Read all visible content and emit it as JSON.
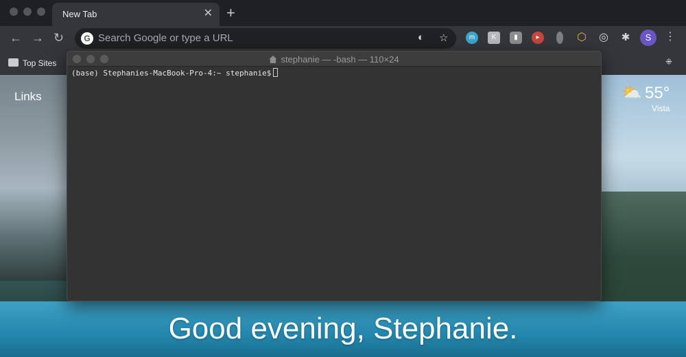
{
  "browser": {
    "tab": {
      "title": "New Tab"
    },
    "omnibox": {
      "placeholder": "Search Google or type a URL"
    },
    "extensions": [
      {
        "name": "m-extension-icon",
        "glyph": "m",
        "color": "#3aa6c9"
      },
      {
        "name": "k-extension-icon",
        "glyph": "K",
        "color": "#b5b8bc"
      },
      {
        "name": "shield-lock-icon",
        "glyph": "🔒",
        "color": "#8a8c90"
      },
      {
        "name": "red-record-icon",
        "glyph": "●",
        "color": "#c8453e"
      },
      {
        "name": "bulb-icon",
        "glyph": "●",
        "color": "#7d7f83"
      },
      {
        "name": "hexagon-icon",
        "glyph": "⬡",
        "color": "#e0a64b"
      },
      {
        "name": "target-icon",
        "glyph": "◎",
        "color": "#d5d7da"
      },
      {
        "name": "puzzle-icon",
        "glyph": "✱",
        "color": "#d5d7da"
      }
    ],
    "avatar_letter": "S",
    "bookmarks": {
      "label": "Top Sites"
    }
  },
  "new_tab": {
    "links_label": "Links",
    "weather": {
      "temp": "55°",
      "city": "Vista"
    },
    "greeting": "Good evening, Stephanie."
  },
  "terminal": {
    "title": "stephanie — -bash — 110×24",
    "prompt": "(base) Stephanies-MacBook-Pro-4:~ stephanie$"
  }
}
